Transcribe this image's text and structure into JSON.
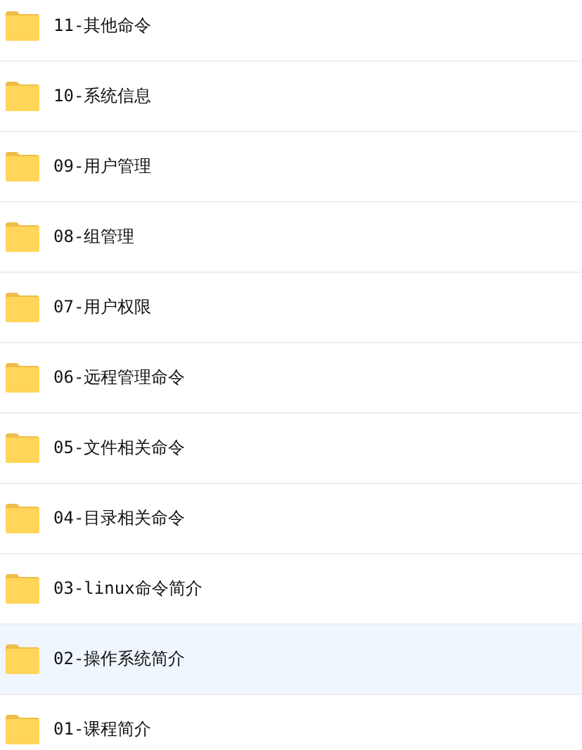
{
  "files": [
    {
      "name": "11-其他命令",
      "selected": false
    },
    {
      "name": "10-系统信息",
      "selected": false
    },
    {
      "name": "09-用户管理",
      "selected": false
    },
    {
      "name": "08-组管理",
      "selected": false
    },
    {
      "name": "07-用户权限",
      "selected": false
    },
    {
      "name": "06-远程管理命令",
      "selected": false
    },
    {
      "name": "05-文件相关命令",
      "selected": false
    },
    {
      "name": "04-目录相关命令",
      "selected": false
    },
    {
      "name": "03-linux命令简介",
      "selected": false
    },
    {
      "name": "02-操作系统简介",
      "selected": true
    },
    {
      "name": "01-课程简介",
      "selected": false
    }
  ]
}
